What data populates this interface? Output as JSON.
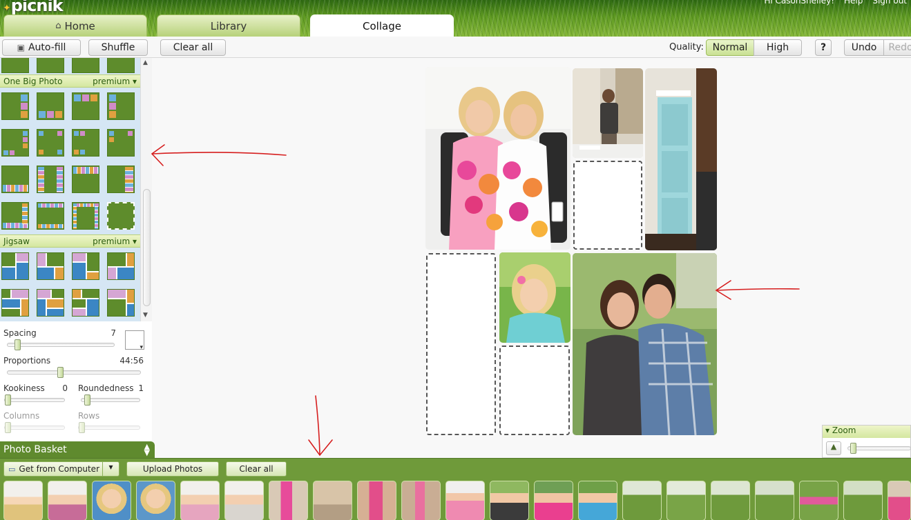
{
  "app": {
    "logo": "picnik",
    "topnav": [
      "Hi CasonShelley!",
      "Help",
      "Sign out"
    ]
  },
  "tabs": [
    {
      "label": "Home",
      "icon": "home-icon"
    },
    {
      "label": "Library"
    },
    {
      "label": "Collage",
      "active": true
    }
  ],
  "toolbar": {
    "autofill": "Auto-fill",
    "shuffle": "Shuffle",
    "clear_all": "Clear all",
    "quality_label": "Quality:",
    "quality_normal": "Normal",
    "quality_high": "High",
    "help": "?",
    "undo": "Undo",
    "redo": "Redo"
  },
  "layouts": {
    "sections": [
      {
        "name": "One Big Photo",
        "premium": "premium"
      },
      {
        "name": "Jigsaw",
        "premium": "premium"
      }
    ]
  },
  "controls": {
    "spacing_label": "Spacing",
    "spacing_value": "7",
    "proportions_label": "Proportions",
    "proportions_value": "44:56",
    "kookiness_label": "Kookiness",
    "kookiness_value": "0",
    "roundedness_label": "Roundedness",
    "roundedness_value": "1",
    "columns_label": "Columns",
    "rows_label": "Rows"
  },
  "zoom": {
    "label": "Zoom"
  },
  "basket": {
    "title": "Photo Basket",
    "get_from_computer": "Get from Computer",
    "upload": "Upload Photos",
    "clear_all": "Clear all"
  },
  "colors": {
    "header_green": "#5f9a22",
    "basket_green": "#6f9a3a",
    "accent": "#2c5d10",
    "annotation_red": "#d61e1e"
  }
}
